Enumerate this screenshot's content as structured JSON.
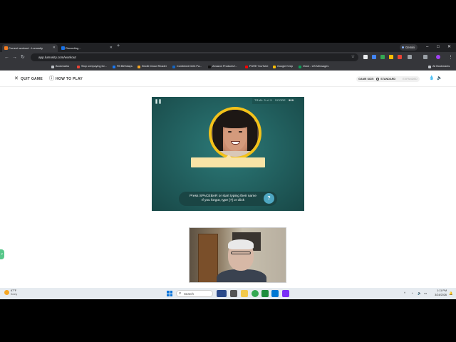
{
  "browser": {
    "tabs": [
      {
        "label": "Current workout - Lumosity",
        "favicon_color": "#f47b20",
        "active": true
      },
      {
        "label": "Recording...",
        "favicon_color": "#1a73e8",
        "active": false
      }
    ],
    "new_tab_label": "+",
    "gemini_label": "Gemini",
    "window_controls": {
      "minimize": "–",
      "maximize": "□",
      "close": "✕"
    },
    "nav": {
      "back": "←",
      "forward": "→",
      "reload": "↻"
    },
    "url": "app.lumosity.com/workout",
    "all_bookmarks_label": "All Bookmarks",
    "bookmarks": [
      {
        "label": "Bookmarks",
        "color": "#bdc1c6"
      },
      {
        "label": "Stop overpaying for...",
        "color": "#ea4335"
      },
      {
        "label": "FB Birthdays",
        "color": "#1877f2"
      },
      {
        "label": "Kindle Cloud Reader",
        "color": "#f5a623"
      },
      {
        "label": "Combined Debt Pa...",
        "color": "#1565c0"
      },
      {
        "label": "Amazon Products f...",
        "color": "#111111"
      },
      {
        "label": "PURE YouTube",
        "color": "#ff0000"
      },
      {
        "label": "Google Keep",
        "color": "#fbbc04"
      },
      {
        "label": "Voice - US Messages",
        "color": "#0f9d58"
      }
    ]
  },
  "lumosity": {
    "quit_label": "QUIT GAME",
    "how_to_play_label": "HOW TO PLAY",
    "game_size_label": "GAME SIZE:",
    "standard_label": "STANDARD",
    "expanded_label": "EXPANDED"
  },
  "game": {
    "trial_label": "TRIAL",
    "trial_value": "3 of 5",
    "score_label": "SCORE",
    "score_value": "300",
    "instruction_line1": "Press SPACEBAR or start typing their name",
    "instruction_line2": "If you forgot, type [?] or click",
    "help_label": "?",
    "name_input_value": ""
  },
  "side_tab_label": "P",
  "taskbar": {
    "weather_temp": "67°F",
    "weather_desc": "Sunny",
    "search_placeholder": "Search",
    "time": "1:11 PM",
    "date": "3/24/2026",
    "tray_chevron": "^"
  },
  "colors": {
    "game_bg": "#215e5d",
    "face_ring": "#f3c21a",
    "name_box": "#f8e3a6",
    "help_button": "#4ea7c2"
  }
}
